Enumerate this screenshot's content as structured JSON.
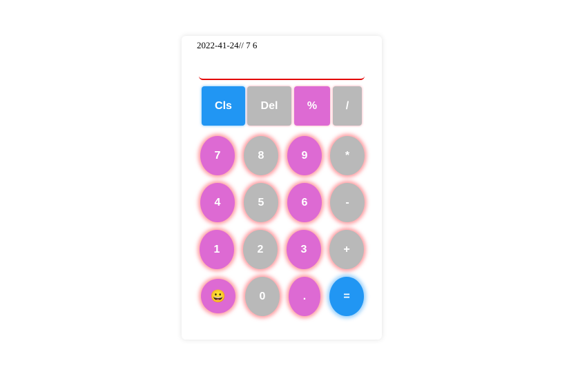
{
  "header": {
    "datetime": "2022-41-24// 7 6"
  },
  "display": {
    "value": ""
  },
  "top_row": {
    "cls": "Cls",
    "del": "Del",
    "percent": "%",
    "divide": "/"
  },
  "keys": {
    "seven": "7",
    "eight": "8",
    "nine": "9",
    "multiply": "*",
    "four": "4",
    "five": "5",
    "six": "6",
    "minus": "-",
    "one": "1",
    "two": "2",
    "three": "3",
    "plus": "+",
    "emoji": "😀",
    "zero": "0",
    "dot": ".",
    "equals": "="
  },
  "colors": {
    "gray": "#b9b9b9",
    "pink": "#dd6ad3",
    "blue": "#2196f3",
    "display_underline": "#e30000"
  }
}
